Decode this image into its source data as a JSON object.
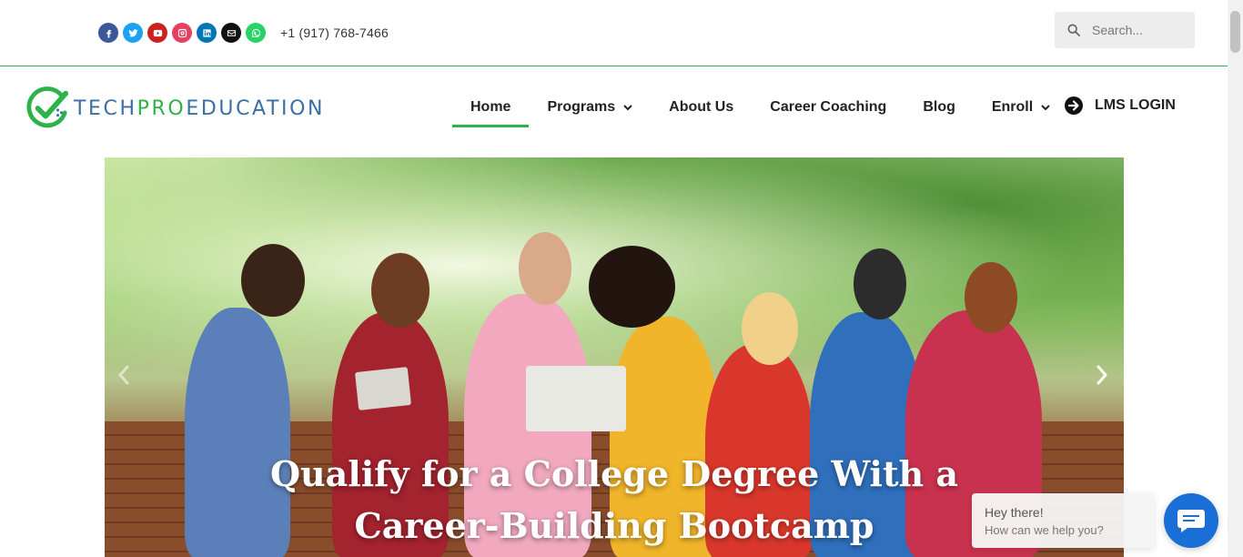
{
  "topbar": {
    "socials": [
      {
        "name": "facebook-icon",
        "color": "#3b5998"
      },
      {
        "name": "twitter-icon",
        "color": "#1da1f2"
      },
      {
        "name": "youtube-icon",
        "color": "#cd201f"
      },
      {
        "name": "instagram-icon",
        "color": "#e4405f"
      },
      {
        "name": "linkedin-icon",
        "color": "#0077b5"
      },
      {
        "name": "envelope-icon",
        "color": "#111111"
      },
      {
        "name": "whatsapp-icon",
        "color": "#25d366"
      }
    ],
    "phone": "+1 (917) 768-7466",
    "search_placeholder": "Search..."
  },
  "header": {
    "logo_text_left": "TECH",
    "logo_text_mid": "PRO",
    "logo_text_right": "EDUCATION",
    "nav": [
      {
        "label": "Home",
        "active": true
      },
      {
        "label": "Programs",
        "dropdown": true
      },
      {
        "label": "About Us"
      },
      {
        "label": "Career Coaching"
      },
      {
        "label": "Blog"
      },
      {
        "label": "Enroll",
        "dropdown": true
      }
    ],
    "lms_label": "LMS LOGIN"
  },
  "hero": {
    "headline_line1": "Qualify for a College Degree With a",
    "headline_line2": "Career-Building Bootcamp"
  },
  "chat": {
    "greeting": "Hey there!",
    "prompt": "How can we help you?"
  },
  "colors": {
    "brand_green": "#2db34a",
    "brand_blue": "#3a6fa8",
    "chat_blue": "#1a6fd6"
  }
}
